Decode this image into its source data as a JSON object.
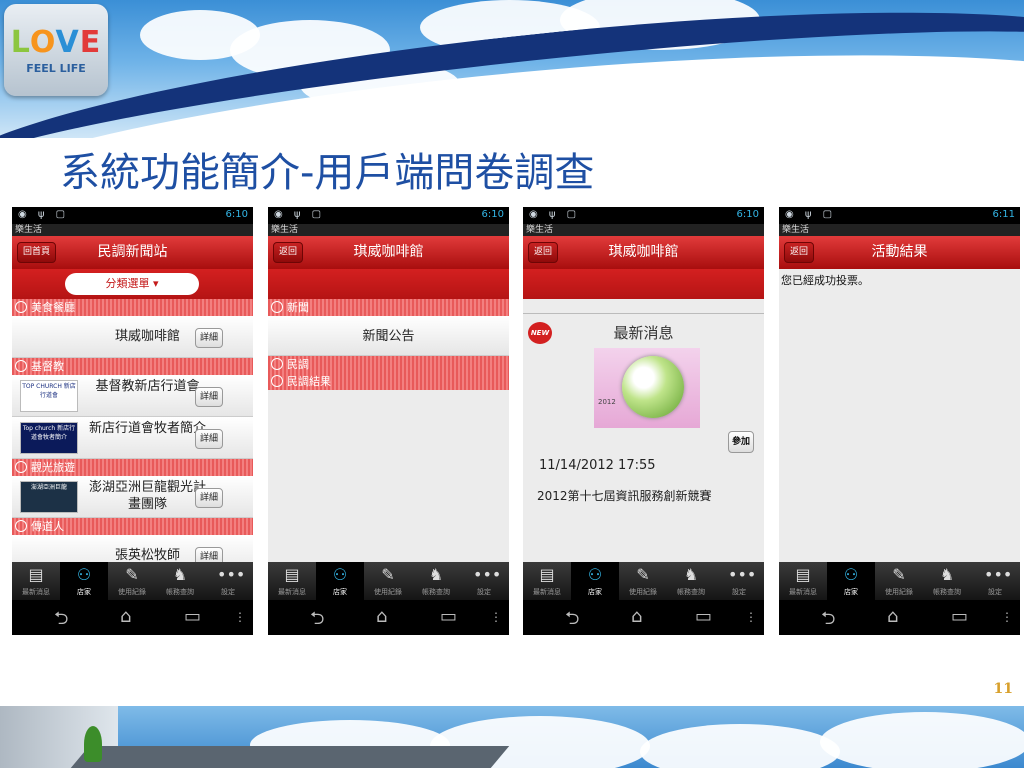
{
  "logo": {
    "text_parts": [
      "L",
      "O",
      "V",
      "E"
    ],
    "subtitle": "FEEL LIFE"
  },
  "slide_title": "系統功能簡介-用戶端問卷調查",
  "page_number": "11",
  "status_times": [
    "6:10",
    "6:10",
    "6:10",
    "6:11"
  ],
  "app_name": "樂生活",
  "phone1": {
    "back_label": "回首頁",
    "title": "民調新聞站",
    "dropdown": "分類選單 ▾",
    "sections": [
      {
        "label": "美食餐廳"
      },
      {
        "label": "基督教"
      },
      {
        "label": "觀光旅遊"
      },
      {
        "label": "傳道人"
      }
    ],
    "rows": [
      {
        "text": "琪威咖啡館",
        "thumb": ""
      },
      {
        "text": "基督教新店行道會",
        "thumb": "TOP CHURCH 新店行道會"
      },
      {
        "text": "新店行道會牧者簡介",
        "thumb": "Top church 新店行道會牧者簡介"
      },
      {
        "text": "澎湖亞洲巨龍觀光計畫團隊",
        "thumb": "澎湖亞洲巨龍"
      },
      {
        "text": "張英松牧師",
        "thumb": ""
      }
    ],
    "detail_label": "詳細"
  },
  "phone2": {
    "back_label": "返回",
    "title": "琪威咖啡館",
    "sections": [
      {
        "label": "新聞"
      },
      {
        "label": "民調"
      },
      {
        "label": "民調結果"
      }
    ],
    "row_text": "新聞公告"
  },
  "phone3": {
    "back_label": "返回",
    "title": "琪威咖啡館",
    "news_badge": "NEW",
    "news_title": "最新消息",
    "image_label": "2012",
    "join_label": "參加",
    "date": "11/14/2012 17:55",
    "event": "2012第十七屆資訊服務創新競賽"
  },
  "phone4": {
    "back_label": "返回",
    "title": "活動結果",
    "message": "您已經成功投票。"
  },
  "tabs": [
    "最新消息",
    "店家",
    "使用紀錄",
    "帳務查詢",
    "設定"
  ],
  "tab_icons": [
    "news-icon",
    "store-icon",
    "history-icon",
    "account-icon",
    "more-icon"
  ],
  "colors": {
    "header_red": "#c41b1b",
    "title_blue": "#1e4fa3",
    "accent": "#33b5e5",
    "page_number": "#d8a02c"
  }
}
